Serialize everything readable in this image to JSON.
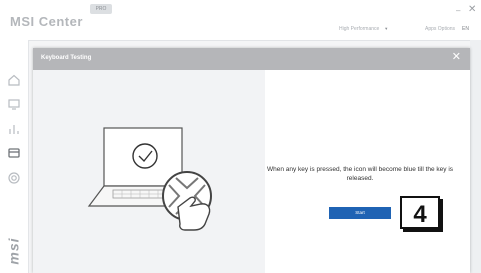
{
  "app": {
    "title": "MSI Center",
    "badge": "PRO",
    "mode": "High Performance",
    "system_options": "Apps Options",
    "language": "EN",
    "minimize": "–",
    "close": "✕"
  },
  "sidebar": {
    "icons": [
      "home-icon",
      "monitor-icon",
      "chart-icon",
      "device-icon",
      "settings-icon"
    ],
    "brand": "msi"
  },
  "modal": {
    "title": "Keyboard Testing",
    "close": "✕",
    "instruction": "When any key is pressed, the icon will become blue till the key is released.",
    "start_label": "Start"
  },
  "step": "4",
  "colors": {
    "accent": "#1f63b4",
    "modal_header": "#b5b6b9",
    "illustration_bg": "#f2f3f5"
  }
}
